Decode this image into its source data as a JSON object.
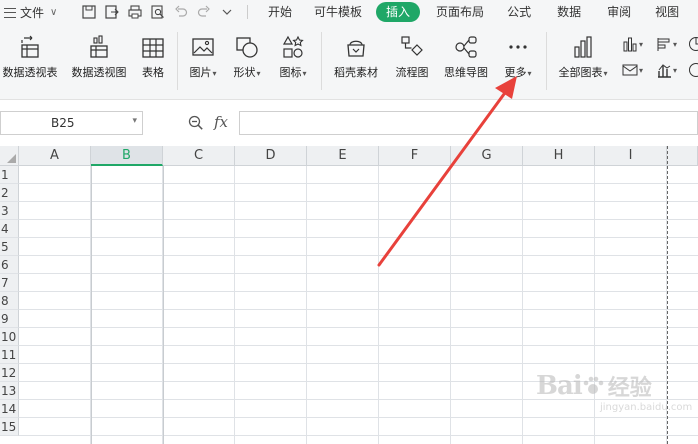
{
  "menu": {
    "file_label": "文件",
    "quick_access": [
      "save-icon",
      "export-icon",
      "print-icon",
      "print-preview-icon",
      "undo-icon",
      "redo-icon",
      "customize-icon"
    ],
    "tabs": [
      "开始",
      "可牛模板",
      "插入",
      "页面布局",
      "公式",
      "数据",
      "审阅",
      "视图"
    ],
    "active_tab": "插入",
    "accent_color": "#1fa767"
  },
  "ribbon": {
    "pivot_table": "数据透视表",
    "pivot_chart": "数据透视图",
    "table": "表格",
    "picture": "图片",
    "shapes": "形状",
    "icons": "图标",
    "material": "稻壳素材",
    "flowchart": "流程图",
    "mindmap": "思维导图",
    "more": "更多",
    "all_charts": "全部图表"
  },
  "formula_bar": {
    "name_box": "B25",
    "fx_label": "fx",
    "formula": ""
  },
  "sheet": {
    "columns": [
      "A",
      "B",
      "C",
      "D",
      "E",
      "F",
      "G",
      "H",
      "I"
    ],
    "selected_column": "B",
    "rows": [
      "1",
      "2",
      "3",
      "4",
      "5",
      "6",
      "7",
      "8",
      "9",
      "10",
      "11",
      "12",
      "13",
      "14",
      "15"
    ]
  },
  "annotation": {
    "color": "#e8413b"
  },
  "watermark": {
    "brand": "Bai",
    "brand2": "经验",
    "url": "jingyan.baidu.com"
  }
}
